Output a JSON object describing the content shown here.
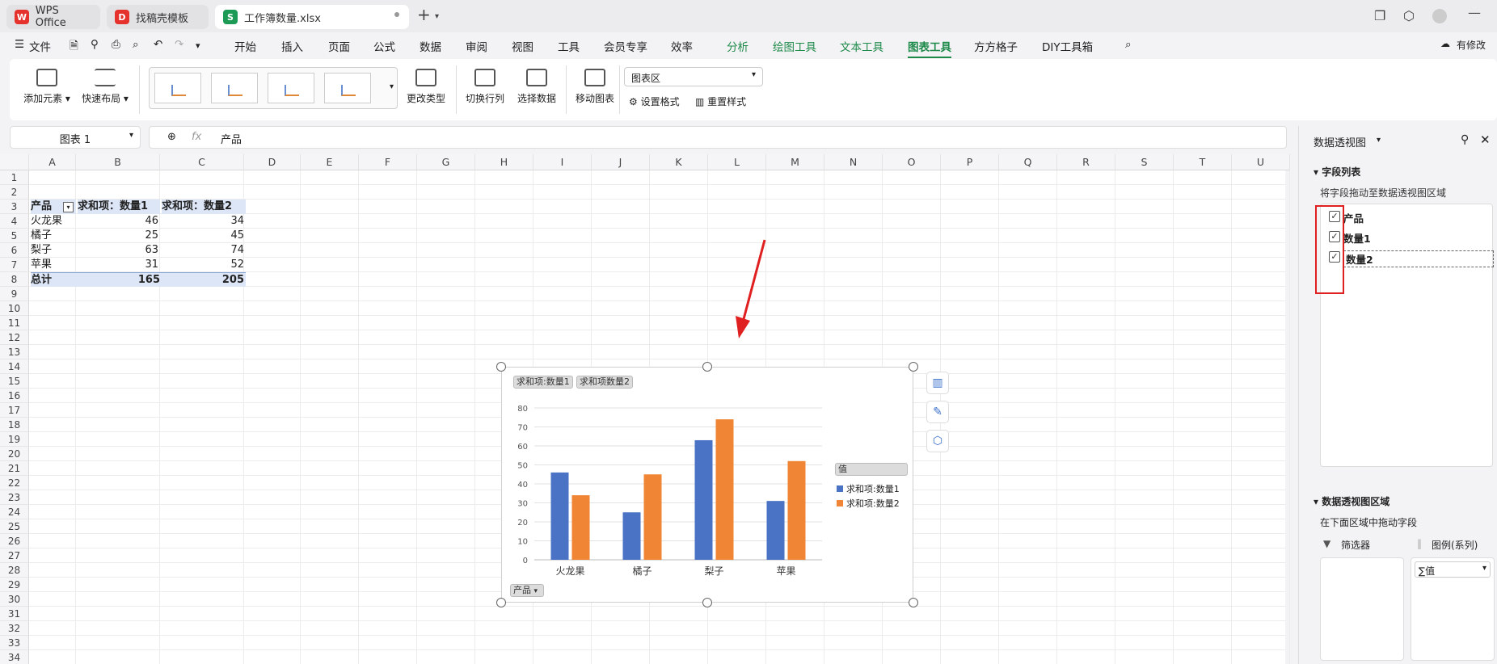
{
  "titlebar": {
    "tabs": [
      {
        "label": "WPS Office"
      },
      {
        "label": "找稿壳模板"
      },
      {
        "label": "工作簿数量.xlsx"
      }
    ]
  },
  "menu": {
    "file": "文件",
    "items": [
      "开始",
      "插入",
      "页面",
      "公式",
      "数据",
      "审阅",
      "视图",
      "工具",
      "会员专享",
      "效率",
      "分析",
      "绘图工具",
      "文本工具",
      "图表工具",
      "方方格子",
      "DIY工具箱"
    ],
    "active": "图表工具",
    "modify": "有修改"
  },
  "ribbon": {
    "add_element": "添加元素",
    "quick_layout": "快速布局",
    "change_type": "更改类型",
    "switch_row_col": "切换行列",
    "select_data": "选择数据",
    "move_chart": "移动图表",
    "area_select": "图表区",
    "set_format": "设置格式",
    "reset_style": "重置样式"
  },
  "formula": {
    "name_box": "图表 1",
    "fx": "fx",
    "content": "产品"
  },
  "columns": [
    "A",
    "B",
    "C",
    "D",
    "E",
    "F",
    "G",
    "H",
    "I",
    "J",
    "K",
    "L",
    "M",
    "N",
    "O",
    "P",
    "Q",
    "R",
    "S",
    "T",
    "U"
  ],
  "rows": [
    "1",
    "2",
    "3",
    "4",
    "5",
    "6",
    "7",
    "8",
    "9",
    "10",
    "11",
    "12",
    "13",
    "14",
    "15",
    "16",
    "17",
    "18",
    "19",
    "20",
    "21",
    "22",
    "23",
    "24",
    "25",
    "26",
    "27",
    "28",
    "29",
    "30",
    "31",
    "32",
    "33",
    "34"
  ],
  "pivot": {
    "header": [
      "产品",
      "求和项：数量1",
      "求和项：数量2"
    ],
    "rows": [
      [
        "火龙果",
        "46",
        "34"
      ],
      [
        "橘子",
        "25",
        "45"
      ],
      [
        "梨子",
        "63",
        "74"
      ],
      [
        "苹果",
        "31",
        "52"
      ]
    ],
    "total": [
      "总计",
      "165",
      "205"
    ]
  },
  "chart_data": {
    "type": "bar",
    "categories": [
      "火龙果",
      "橘子",
      "梨子",
      "苹果"
    ],
    "series": [
      {
        "name": "求和项:数量1",
        "values": [
          46,
          25,
          63,
          31
        ],
        "color": "#4a73c6"
      },
      {
        "name": "求和项:数量2",
        "values": [
          34,
          45,
          74,
          52
        ],
        "color": "#ef8535"
      }
    ],
    "ylim": [
      0,
      80
    ],
    "yticks": [
      "0",
      "10",
      "20",
      "30",
      "40",
      "50",
      "60",
      "70",
      "80"
    ],
    "field_buttons": [
      "求和项:数量1",
      "求和项数量2"
    ],
    "legend_title": "值",
    "axis_button": "产品",
    "legend_position": "right",
    "grid": true
  },
  "pane": {
    "title": "数据透视图",
    "field_list": "字段列表",
    "hint": "将字段拖动至数据透视图区域",
    "fields": [
      {
        "label": "产品",
        "checked": true
      },
      {
        "label": "数量1",
        "checked": true
      },
      {
        "label": "数量2",
        "checked": true
      }
    ],
    "area_title": "数据透视图区域",
    "area_hint": "在下面区域中拖动字段",
    "filter": "筛选器",
    "legend": "图例(系列)",
    "value_item": "∑值"
  },
  "colors": {
    "accent": "#1e8a4a",
    "annotation": "#e02020"
  }
}
